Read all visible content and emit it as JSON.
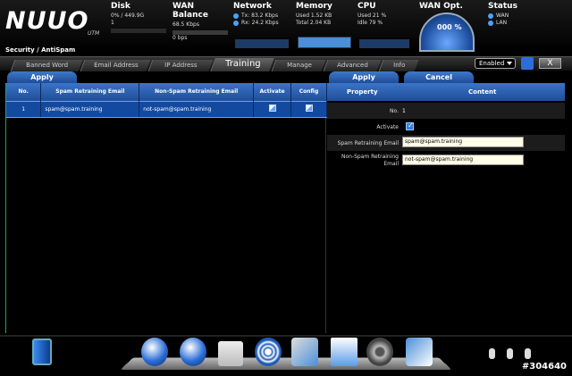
{
  "header": {
    "logo": "NUUO",
    "logo_sub": "UTM",
    "disk": {
      "title": "Disk",
      "line1": "0% / 449.9G",
      "line2": "1"
    },
    "wan_balance": {
      "title": "WAN Balance",
      "line1": "68.5 Kbps",
      "line2": "0 bps"
    },
    "network": {
      "title": "Network",
      "tx": "Tx:  83.2 Kbps",
      "rx": "Rx:  24.2 Kbps"
    },
    "memory": {
      "title": "Memory",
      "used": "Used     1.52 KB",
      "total": "Total    2.04 KB"
    },
    "cpu": {
      "title": "CPU",
      "used": "Used     21 %",
      "idle": "Idle      79 %"
    },
    "wan_opt": {
      "title": "WAN Opt.",
      "value": "000 %"
    },
    "status": {
      "title": "Status",
      "wan": "WAN",
      "lan": "LAN"
    }
  },
  "breadcrumb": "Security / AntiSpam",
  "tabs": [
    {
      "label": "Banned Word"
    },
    {
      "label": "Email Address"
    },
    {
      "label": "IP Address"
    },
    {
      "label": "Training"
    },
    {
      "label": "Manage"
    },
    {
      "label": "Advanced"
    },
    {
      "label": "Info"
    }
  ],
  "enabled_select": "Enabled",
  "close_label": "X",
  "left": {
    "apply_label": "Apply",
    "columns": [
      "No.",
      "Spam Retraining Email",
      "Non-Spam Retraining Email",
      "Activate",
      "Config"
    ],
    "rows": [
      {
        "no": "1",
        "spam": "spam@spam.training",
        "nonspam": "not-spam@spam.training"
      }
    ]
  },
  "right": {
    "apply_label": "Apply",
    "cancel_label": "Cancel",
    "col_property": "Property",
    "col_content": "Content",
    "no_label": "No.",
    "no_value": "1",
    "activate_label": "Activate",
    "spam_label": "Spam Retraining Email",
    "spam_value": "spam@spam.training",
    "nonspam_label": "Non-Spam Retraining Email",
    "nonspam_value": "not-spam@spam.training"
  },
  "watermark": "#304640",
  "colors": {
    "accent": "#1f4d98",
    "row_selected": "#134aa0",
    "field_bg": "#ffffe8"
  }
}
